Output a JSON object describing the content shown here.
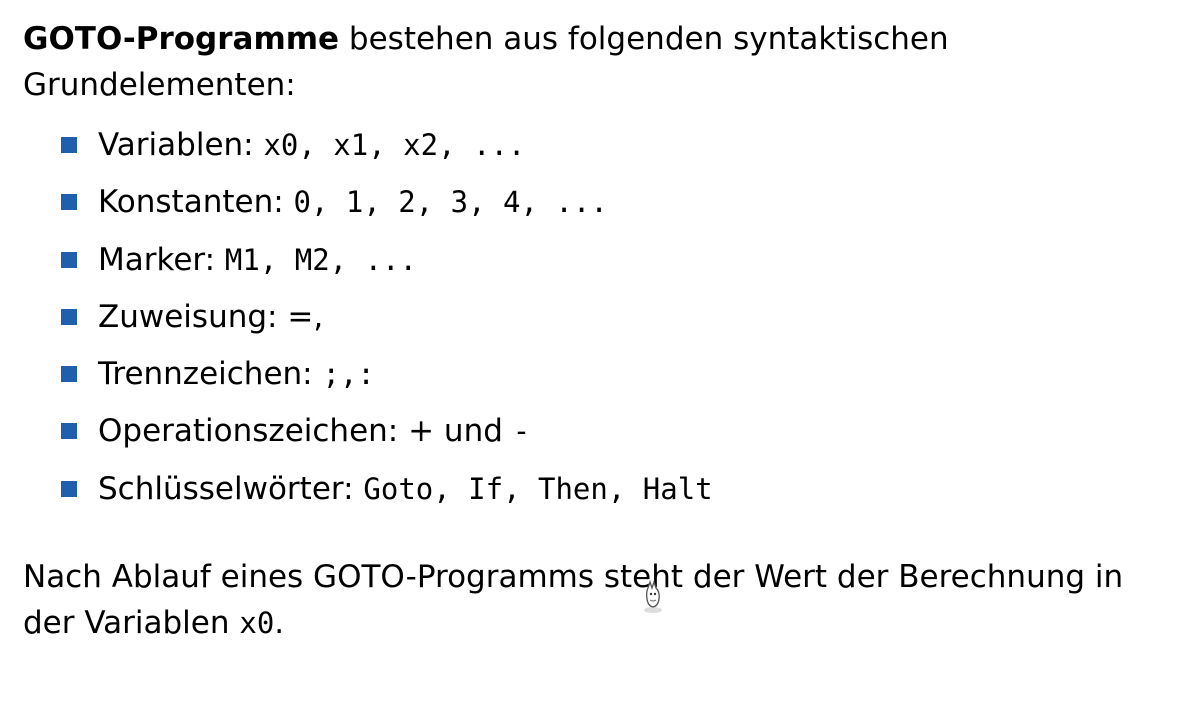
{
  "intro": {
    "bold": "GOTO-Programme",
    "rest": " bestehen aus folgenden syntaktischen Grundelementen:"
  },
  "items": [
    {
      "label": "Variablen: ",
      "code": "x0, x1, x2, ..."
    },
    {
      "label": "Konstanten: ",
      "code": "0, 1, 2, 3, 4, ..."
    },
    {
      "label": "Marker: ",
      "code": "M1, M2, ..."
    },
    {
      "label": "Zuweisung: =,",
      "code": ""
    },
    {
      "label": "Trennzeichen: ",
      "code": ";,:"
    },
    {
      "label": "Operationszeichen: + und ",
      "code": "-"
    },
    {
      "label": "Schlüsselwörter: ",
      "code": "Goto, If, Then, Halt"
    }
  ],
  "outro": {
    "text": "Nach Ablauf eines GOTO-Programms steht der Wert der Berechnung in der Variablen ",
    "code": "x0",
    "end": "."
  },
  "colors": {
    "bullet": "#1f5fae"
  },
  "cursor": {
    "icon": "bug-cursor-icon"
  }
}
